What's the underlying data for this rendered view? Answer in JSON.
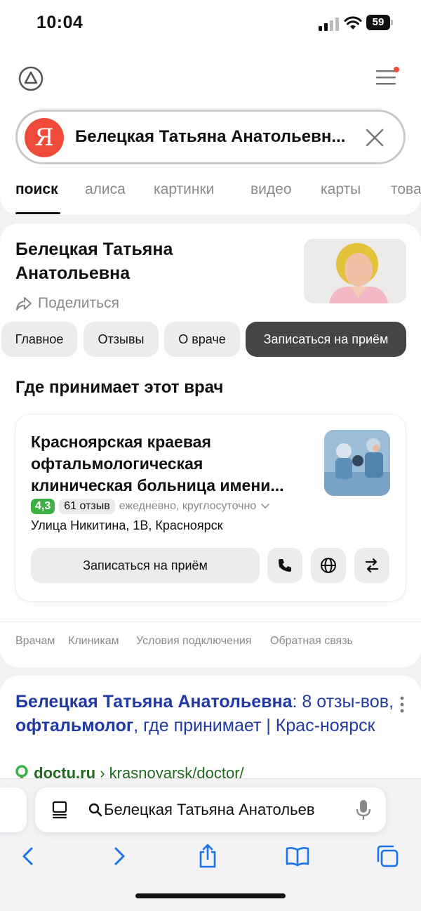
{
  "status": {
    "time": "10:04",
    "battery": "59"
  },
  "search": {
    "query": "Белецкая Татьяна Анатольевн...",
    "logo_letter": "Я"
  },
  "tabs": [
    "поиск",
    "алиса",
    "картинки",
    "видео",
    "карты",
    "това"
  ],
  "doctor": {
    "name": "Белецкая Татьяна Анатольевна",
    "share_label": "Поделиться"
  },
  "chips": [
    "Главное",
    "Отзывы",
    "О враче",
    "Записаться на приём"
  ],
  "section_title": "Где принимает этот врач",
  "clinic": {
    "name": "Красноярская краевая офтальмологическая клиническая больница имени...",
    "rating": "4,3",
    "reviews": "61 отзыв",
    "hours": "ежедневно, круглосуточно",
    "address": "Улица Никитина, 1В, Красноярск",
    "book_label": "Записаться на приём"
  },
  "footer_links": [
    "Врачам",
    "Клиникам",
    "Условия подключения",
    "Обратная связь"
  ],
  "result": {
    "title_part1": "Белецкая Татьяна Анатольевна",
    "title_part2": ": 8 отзы-вов, ",
    "title_part3": "офтальмолог",
    "title_part4": ", где принимает | Крас-ноярск",
    "source_domain": "doctu.ru",
    "source_path": " › krasnoyarsk/doctor/"
  },
  "safari": {
    "address_text": "Белецкая Татьяна Анатольев"
  },
  "colors": {
    "brand_red": "#f04a3b",
    "rating_green": "#3cb043",
    "link_blue": "#1f3aa3",
    "ios_blue": "#1a73e8"
  }
}
